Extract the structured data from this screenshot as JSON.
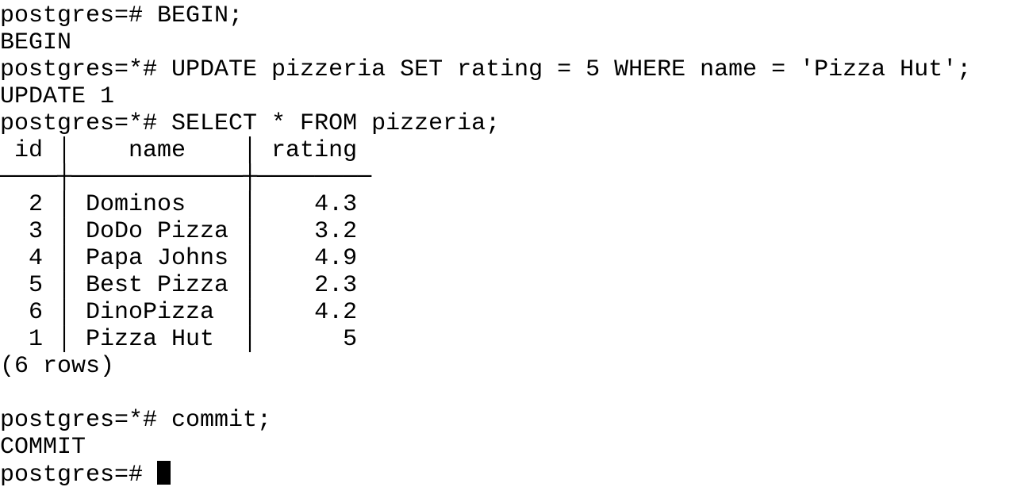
{
  "terminal": {
    "lines": [
      "postgres=# BEGIN;",
      "BEGIN",
      "postgres=*# UPDATE pizzeria SET rating = 5 WHERE name = 'Pizza Hut';",
      "UPDATE 1",
      "postgres=*# SELECT * FROM pizzeria;",
      " id │    name    │ rating",
      "────┼────────────┼────────",
      "  2 │ Dominos    │    4.3",
      "  3 │ DoDo Pizza │    3.2",
      "  4 │ Papa Johns │    4.9",
      "  5 │ Best Pizza │    2.3",
      "  6 │ DinoPizza  │    4.2",
      "  1 │ Pizza Hut  │      5",
      "(6 rows)",
      "",
      "postgres=*# commit;",
      "COMMIT",
      "postgres=# "
    ]
  }
}
